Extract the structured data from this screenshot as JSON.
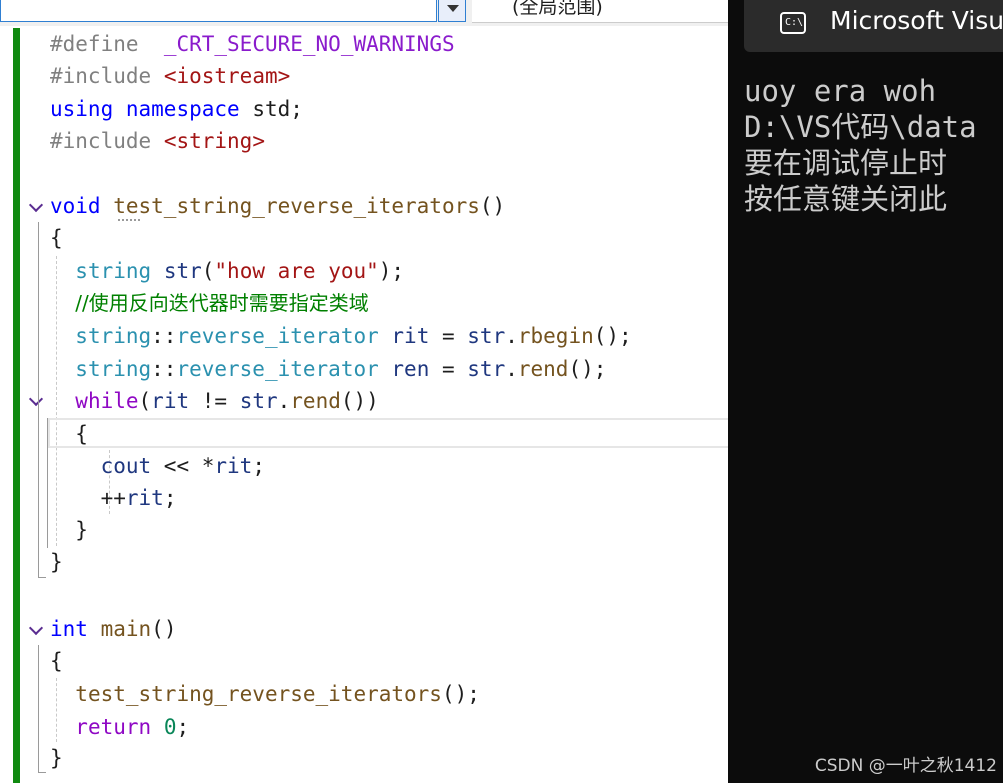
{
  "toolbar": {
    "scope_label": "(全局范围)"
  },
  "code": {
    "l1": {
      "directive": "#define",
      "macro": "_CRT_SECURE_NO_WARNINGS"
    },
    "l2": {
      "directive": "#include",
      "header": "<iostream>"
    },
    "l3": {
      "kw1": "using",
      "kw2": "namespace",
      "name": "std;"
    },
    "l4": {
      "directive": "#include",
      "header": "<string>"
    },
    "l6": {
      "kw": "void",
      "fn": "test_string_reverse_iterators",
      "rest": "()"
    },
    "l7": {
      "text": "{"
    },
    "l8": {
      "type": "string",
      "var": "str",
      "p1": "(",
      "str": "\"how are you\"",
      "p2": ");"
    },
    "l9": {
      "comment": "//使用反向迭代器时需要指定类域"
    },
    "l10": {
      "type": "string",
      "sep": "::",
      "type2": "reverse_iterator",
      "var": "rit",
      "eq": " = ",
      "obj": "str",
      "dot": ".",
      "fn": "rbegin",
      "end": "();"
    },
    "l11": {
      "type": "string",
      "sep": "::",
      "type2": "reverse_iterator",
      "var": "ren",
      "eq": " = ",
      "obj": "str",
      "dot": ".",
      "fn": "rend",
      "end": "();"
    },
    "l12": {
      "kw": "while",
      "p1": "(",
      "var": "rit",
      "op": " != ",
      "obj": "str",
      "dot": ".",
      "fn": "rend",
      "end": "())"
    },
    "l13": {
      "text": "{"
    },
    "l14": {
      "var": "cout",
      "op": " << ",
      "deref": "*",
      "var2": "rit",
      "end": ";"
    },
    "l15": {
      "op": "++",
      "var": "rit",
      "end": ";"
    },
    "l16": {
      "text": "}"
    },
    "l17": {
      "text": "}"
    },
    "l19": {
      "kw": "int",
      "fn": "main",
      "rest": "()"
    },
    "l20": {
      "text": "{"
    },
    "l21": {
      "fn": "test_string_reverse_iterators",
      "end": "();"
    },
    "l22": {
      "kw": "return",
      "num": "0",
      "end": ";"
    },
    "l23": {
      "text": "}"
    }
  },
  "console": {
    "title": "Microsoft Visua",
    "lines": [
      "uoy era woh",
      "D:\\VS代码\\data",
      "要在调试停止时",
      "按任意键关闭此"
    ],
    "watermark": "CSDN @一叶之秋1412"
  },
  "colors": {
    "editor_bg": "#ffffff",
    "console_bg": "#0c0c0c",
    "change_bar": "#108a10",
    "keyword": "#0000ff",
    "type": "#2b91af",
    "comment": "#008000",
    "string": "#a31515"
  }
}
